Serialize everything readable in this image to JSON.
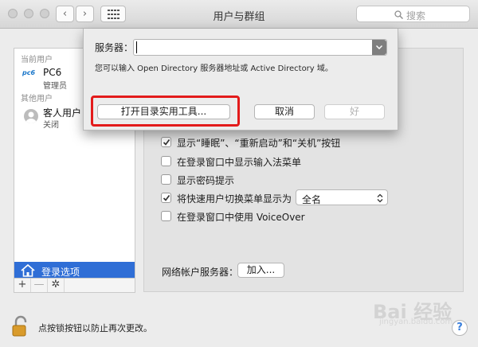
{
  "window": {
    "title": "用户与群组",
    "search_placeholder": "搜索"
  },
  "toolbar": {
    "back": "‹",
    "forward": "›"
  },
  "sidebar": {
    "current_users_header": "当前用户",
    "current_user": {
      "logo": "pc6",
      "name": "PC6",
      "role": "管理员"
    },
    "other_users_header": "其他用户",
    "guest_user": {
      "name": "客人用户",
      "status": "关闭"
    },
    "login_options_label": "登录选项",
    "add": "+",
    "remove": "—",
    "gear": "✲"
  },
  "options": [
    {
      "label": "显示“睡眠”、“重新启动”和“关机”按钮",
      "checked": true
    },
    {
      "label": "在登录窗口中显示输入法菜单",
      "checked": false
    },
    {
      "label": "显示密码提示",
      "checked": false
    },
    {
      "label": "将快速用户切换菜单显示为",
      "checked": true
    },
    {
      "label": "在登录窗口中使用 VoiceOver",
      "checked": false
    }
  ],
  "fast_switch_select": "全名",
  "network_server_label": "网络帐户服务器：",
  "join_button": "加入...",
  "lock_text": "点按锁按钮以防止再次更改。",
  "help": "?",
  "sheet": {
    "server_label": "服务器：",
    "server_value": "",
    "hint": "您可以输入 Open Directory 服务器地址或 Active Directory 域。",
    "open_utility_button": "打开目录实用工具...",
    "cancel_button": "取消",
    "ok_button": "好"
  },
  "watermark": {
    "logo": "Bai 经验",
    "url": "jingyan.baidu.com"
  },
  "colors": {
    "selection": "#2f6ed6",
    "highlight": "#e31b1b"
  }
}
